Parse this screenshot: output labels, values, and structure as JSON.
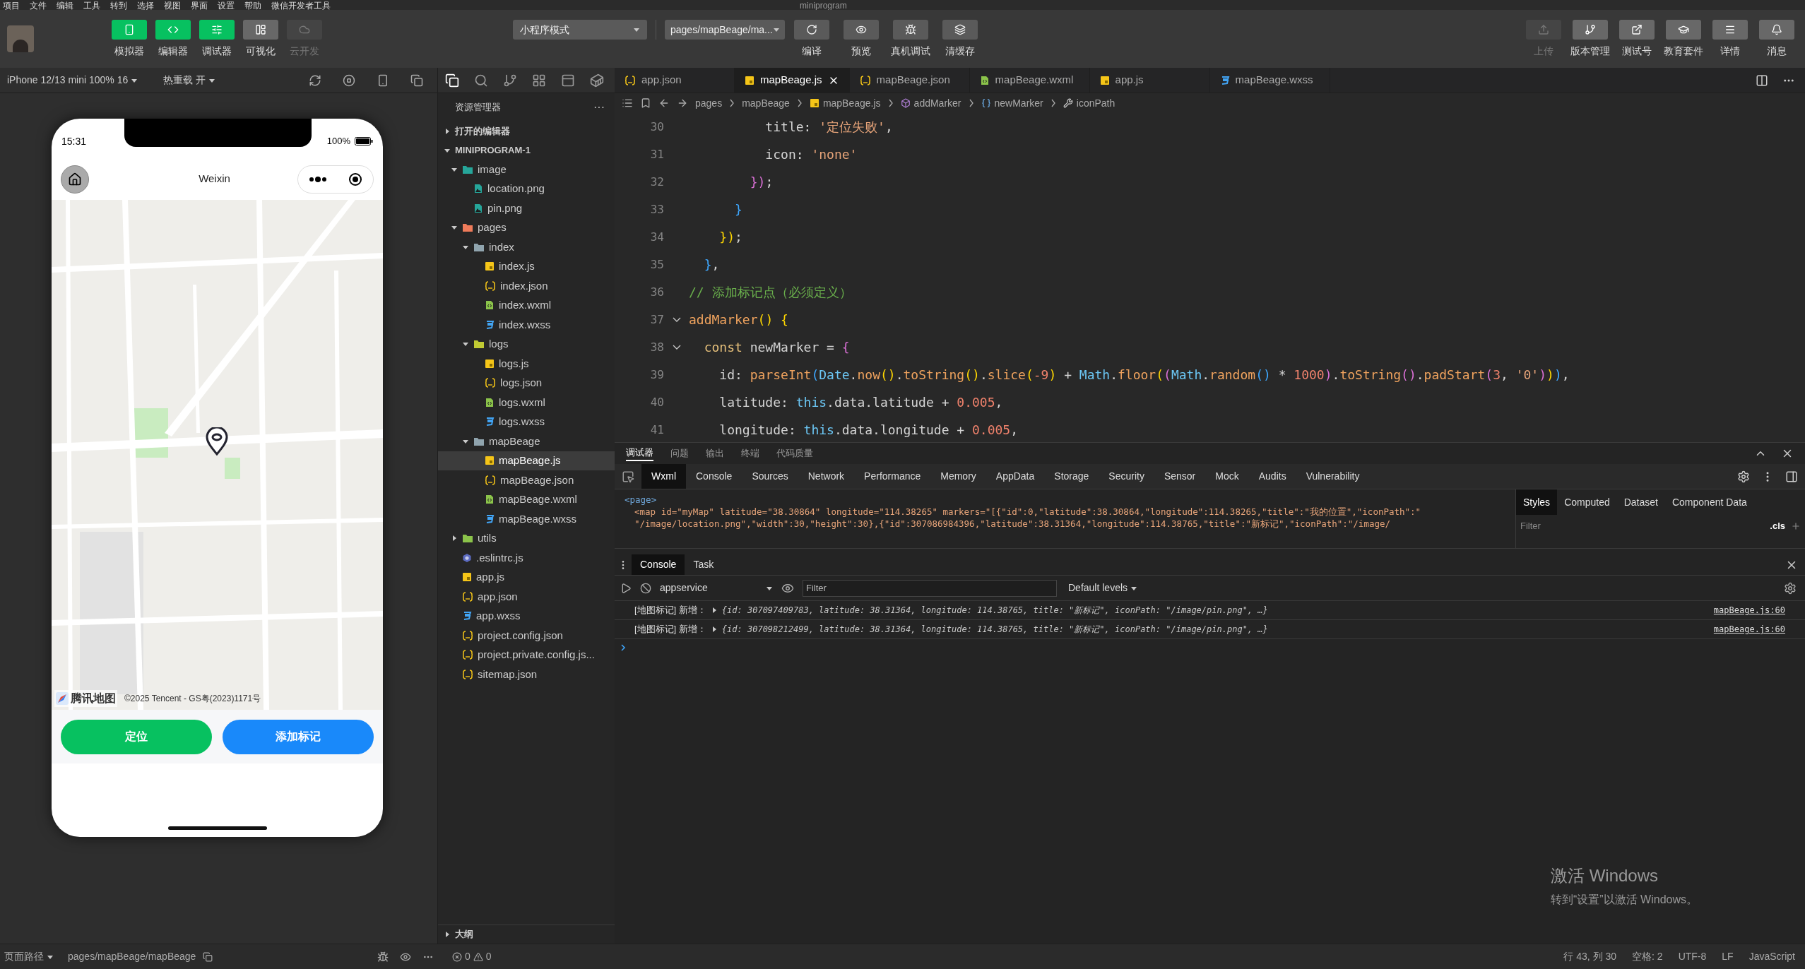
{
  "menu_bar": {
    "items": [
      "项目",
      "文件",
      "编辑",
      "工具",
      "转到",
      "选择",
      "视图",
      "界面",
      "设置",
      "帮助",
      "微信开发者工具"
    ],
    "title": "miniprogram"
  },
  "toolbar": {
    "left_buttons": [
      {
        "label": "模拟器",
        "selected": true,
        "disabled": false
      },
      {
        "label": "编辑器",
        "selected": true,
        "disabled": false
      },
      {
        "label": "调试器",
        "selected": true,
        "disabled": false
      },
      {
        "label": "可视化",
        "selected": false,
        "disabled": false
      },
      {
        "label": "云开发",
        "selected": false,
        "disabled": true
      }
    ],
    "mode_select": "小程序模式",
    "page_select": "pages/mapBeage/ma...",
    "center_buttons": [
      "编译",
      "预览",
      "真机调试",
      "清缓存"
    ],
    "right_buttons": [
      {
        "label": "上传",
        "disabled": true
      },
      {
        "label": "版本管理",
        "disabled": false
      },
      {
        "label": "测试号",
        "disabled": false
      },
      {
        "label": "教育套件",
        "disabled": false
      },
      {
        "label": "详情",
        "disabled": false
      },
      {
        "label": "消息",
        "disabled": false
      }
    ]
  },
  "simulator": {
    "device": "iPhone 12/13 mini 100% 16",
    "hot_reload": "热重载 开",
    "phone": {
      "time": "15:31",
      "battery": "100%",
      "nav_title": "Weixin",
      "map_logo": "腾讯地图",
      "map_copyright": "©2025 Tencent - GS粤(2023)1171号",
      "buttons": [
        {
          "label": "定位",
          "color": "#07c160"
        },
        {
          "label": "添加标记",
          "color": "#1989fa"
        }
      ]
    }
  },
  "explorer": {
    "title": "资源管理器",
    "more": "···",
    "sections": [
      {
        "label": "打开的编辑器",
        "expanded": false
      },
      {
        "label": "MINIPROGRAM-1",
        "expanded": true
      }
    ],
    "tree": [
      {
        "name": "image",
        "kind": "folder-image",
        "expanded": true,
        "selected": false,
        "children": [
          {
            "name": "location.png",
            "kind": "png",
            "selected": false
          },
          {
            "name": "pin.png",
            "kind": "png",
            "selected": false
          }
        ]
      },
      {
        "name": "pages",
        "kind": "folder-pages",
        "expanded": true,
        "selected": false,
        "children": [
          {
            "name": "index",
            "kind": "folder",
            "expanded": true,
            "selected": false,
            "children": [
              {
                "name": "index.js",
                "kind": "js",
                "selected": false
              },
              {
                "name": "index.json",
                "kind": "json",
                "selected": false
              },
              {
                "name": "index.wxml",
                "kind": "wxml",
                "selected": false
              },
              {
                "name": "index.wxss",
                "kind": "wxss",
                "selected": false
              }
            ]
          },
          {
            "name": "logs",
            "kind": "folder-logs",
            "expanded": true,
            "selected": false,
            "children": [
              {
                "name": "logs.js",
                "kind": "js",
                "selected": false
              },
              {
                "name": "logs.json",
                "kind": "json",
                "selected": false
              },
              {
                "name": "logs.wxml",
                "kind": "wxml",
                "selected": false
              },
              {
                "name": "logs.wxss",
                "kind": "wxss",
                "selected": false
              }
            ]
          },
          {
            "name": "mapBeage",
            "kind": "folder",
            "expanded": true,
            "selected": false,
            "children": [
              {
                "name": "mapBeage.js",
                "kind": "js",
                "selected": true
              },
              {
                "name": "mapBeage.json",
                "kind": "json",
                "selected": false
              },
              {
                "name": "mapBeage.wxml",
                "kind": "wxml",
                "selected": false
              },
              {
                "name": "mapBeage.wxss",
                "kind": "wxss",
                "selected": false
              }
            ]
          }
        ]
      },
      {
        "name": "utils",
        "kind": "folder-utils",
        "expanded": false,
        "selected": false
      },
      {
        "name": ".eslintrc.js",
        "kind": "eslint",
        "selected": false
      },
      {
        "name": "app.js",
        "kind": "js",
        "selected": false
      },
      {
        "name": "app.json",
        "kind": "json",
        "selected": false
      },
      {
        "name": "app.wxss",
        "kind": "wxss",
        "selected": false
      },
      {
        "name": "project.config.json",
        "kind": "json",
        "selected": false
      },
      {
        "name": "project.private.config.js...",
        "kind": "json",
        "selected": false
      },
      {
        "name": "sitemap.json",
        "kind": "json",
        "selected": false
      }
    ],
    "outline": {
      "label": "大纲",
      "expanded": false
    },
    "errors": "0",
    "warnings": "0"
  },
  "editor": {
    "tabs": [
      {
        "label": "app.json",
        "kind": "json",
        "selected": false
      },
      {
        "label": "mapBeage.js",
        "kind": "js",
        "selected": true
      },
      {
        "label": "mapBeage.json",
        "kind": "json",
        "selected": false
      },
      {
        "label": "mapBeage.wxml",
        "kind": "wxml",
        "selected": false
      },
      {
        "label": "app.js",
        "kind": "js",
        "selected": false
      },
      {
        "label": "mapBeage.wxss",
        "kind": "wxss",
        "selected": false
      }
    ],
    "breadcrumb": [
      "pages",
      "mapBeage",
      "mapBeage.js",
      "addMarker",
      "newMarker",
      "iconPath"
    ],
    "lines": [
      {
        "number": "30",
        "fold": false,
        "tokens": [
          {
            "kind": "key",
            "text": "          title: "
          },
          {
            "kind": "str",
            "text": "'定位失败'"
          },
          {
            "kind": "p",
            "text": ","
          }
        ]
      },
      {
        "number": "31",
        "fold": false,
        "tokens": [
          {
            "kind": "key",
            "text": "          icon: "
          },
          {
            "kind": "str",
            "text": "'none'"
          }
        ]
      },
      {
        "number": "32",
        "fold": false,
        "tokens": [
          {
            "kind": "b2",
            "text": "        })"
          },
          {
            "kind": "p",
            "text": ";"
          }
        ]
      },
      {
        "number": "33",
        "fold": false,
        "tokens": [
          {
            "kind": "b3",
            "text": "      }"
          }
        ]
      },
      {
        "number": "34",
        "fold": false,
        "tokens": [
          {
            "kind": "b1",
            "text": "    })"
          },
          {
            "kind": "p",
            "text": ";"
          }
        ]
      },
      {
        "number": "35",
        "fold": false,
        "tokens": [
          {
            "kind": "b3",
            "text": "  }"
          },
          {
            "kind": "p",
            "text": ","
          }
        ]
      },
      {
        "number": "36",
        "fold": false,
        "tokens": [
          {
            "kind": "comment",
            "text": "// 添加标记点（必须定义）"
          }
        ]
      },
      {
        "number": "37",
        "fold": true,
        "tokens": [
          {
            "kind": "fn",
            "text": "addMarker"
          },
          {
            "kind": "b1",
            "text": "()"
          },
          {
            "kind": "b1",
            "text": " {"
          }
        ]
      },
      {
        "number": "38",
        "fold": true,
        "tokens": [
          {
            "kind": "kw",
            "text": "  const"
          },
          {
            "kind": "p",
            "text": " newMarker = "
          },
          {
            "kind": "b2",
            "text": "{"
          }
        ]
      },
      {
        "number": "39",
        "fold": false,
        "tokens": [
          {
            "kind": "key",
            "text": "    id: "
          },
          {
            "kind": "fn",
            "text": "parseInt"
          },
          {
            "kind": "b3",
            "text": "("
          },
          {
            "kind": "obj",
            "text": "Date"
          },
          {
            "kind": "p",
            "text": "."
          },
          {
            "kind": "fn",
            "text": "now"
          },
          {
            "kind": "b1",
            "text": "()"
          },
          {
            "kind": "p",
            "text": "."
          },
          {
            "kind": "fn",
            "text": "toString"
          },
          {
            "kind": "b1",
            "text": "()"
          },
          {
            "kind": "p",
            "text": "."
          },
          {
            "kind": "fn",
            "text": "slice"
          },
          {
            "kind": "b1",
            "text": "("
          },
          {
            "kind": "num",
            "text": "-9"
          },
          {
            "kind": "b1",
            "text": ")"
          },
          {
            "kind": "p",
            "text": " + "
          },
          {
            "kind": "obj",
            "text": "Math"
          },
          {
            "kind": "p",
            "text": "."
          },
          {
            "kind": "fn",
            "text": "floor"
          },
          {
            "kind": "b1",
            "text": "("
          },
          {
            "kind": "b2",
            "text": "("
          },
          {
            "kind": "obj",
            "text": "Math"
          },
          {
            "kind": "p",
            "text": "."
          },
          {
            "kind": "fn",
            "text": "random"
          },
          {
            "kind": "b3",
            "text": "()"
          },
          {
            "kind": "p",
            "text": " * "
          },
          {
            "kind": "num",
            "text": "1000"
          },
          {
            "kind": "b2",
            "text": ")"
          },
          {
            "kind": "p",
            "text": "."
          },
          {
            "kind": "fn",
            "text": "toString"
          },
          {
            "kind": "b2",
            "text": "()"
          },
          {
            "kind": "p",
            "text": "."
          },
          {
            "kind": "fn",
            "text": "padStart"
          },
          {
            "kind": "b2",
            "text": "("
          },
          {
            "kind": "num",
            "text": "3"
          },
          {
            "kind": "p",
            "text": ", "
          },
          {
            "kind": "str",
            "text": "'0'"
          },
          {
            "kind": "b2",
            "text": ")"
          },
          {
            "kind": "b1",
            "text": ")"
          },
          {
            "kind": "b3",
            "text": ")"
          },
          {
            "kind": "p",
            "text": ","
          }
        ]
      },
      {
        "number": "40",
        "fold": false,
        "tokens": [
          {
            "kind": "key",
            "text": "    latitude: "
          },
          {
            "kind": "obj",
            "text": "this"
          },
          {
            "kind": "p",
            "text": ".data.latitude + "
          },
          {
            "kind": "num",
            "text": "0.005"
          },
          {
            "kind": "p",
            "text": ","
          }
        ]
      },
      {
        "number": "41",
        "fold": false,
        "tokens": [
          {
            "kind": "key",
            "text": "    longitude: "
          },
          {
            "kind": "obj",
            "text": "this"
          },
          {
            "kind": "p",
            "text": ".data.longitude + "
          },
          {
            "kind": "num",
            "text": "0.005"
          },
          {
            "kind": "p",
            "text": ","
          }
        ]
      }
    ]
  },
  "devtools": {
    "top_tabs": [
      {
        "label": "调试器",
        "selected": true
      },
      {
        "label": "问题",
        "selected": false
      },
      {
        "label": "输出",
        "selected": false
      },
      {
        "label": "终端",
        "selected": false
      },
      {
        "label": "代码质量",
        "selected": false
      }
    ],
    "panel_tabs": [
      {
        "label": "Wxml",
        "selected": true
      },
      {
        "label": "Console",
        "selected": false
      },
      {
        "label": "Sources",
        "selected": false
      },
      {
        "label": "Network",
        "selected": false
      },
      {
        "label": "Performance",
        "selected": false
      },
      {
        "label": "Memory",
        "selected": false
      },
      {
        "label": "AppData",
        "selected": false
      },
      {
        "label": "Storage",
        "selected": false
      },
      {
        "label": "Security",
        "selected": false
      },
      {
        "label": "Sensor",
        "selected": false
      },
      {
        "label": "Mock",
        "selected": false
      },
      {
        "label": "Audits",
        "selected": false
      },
      {
        "label": "Vulnerability",
        "selected": false
      }
    ],
    "wxml_lines": [
      {
        "kind": "tag",
        "text": "<page>"
      },
      {
        "kind": "attrs",
        "text": "<map id=\"myMap\" latitude=\"38.30864\" longitude=\"114.38265\" markers=\"[{\"id\":0,\"latitude\":38.30864,\"longitude\":114.38265,\"title\":\"我的位置\",\"iconPath\":\""
      },
      {
        "kind": "attrs",
        "text": "\"/image/location.png\",\"width\":30,\"height\":30},{\"id\":307086984396,\"latitude\":38.31364,\"longitude\":114.38765,\"title\":\"新标记\",\"iconPath\":\"/image/"
      }
    ],
    "style_tabs": [
      {
        "label": "Styles",
        "selected": true
      },
      {
        "label": "Computed",
        "selected": false
      },
      {
        "label": "Dataset",
        "selected": false
      },
      {
        "label": "Component Data",
        "selected": false
      }
    ],
    "style_filter": {
      "placeholder": "Filter"
    },
    "cls": ".cls",
    "drawer_tabs": [
      {
        "label": "Console",
        "selected": true
      },
      {
        "label": "Task",
        "selected": false
      }
    ],
    "context": "appservice",
    "console_filter": {
      "placeholder": "Filter"
    },
    "levels": "Default levels",
    "logs": [
      {
        "prefix": "[地图标记] 新增：",
        "object": "{id: 307097409783, latitude: 38.31364, longitude: 114.38765, title: \"新标记\", iconPath: \"/image/pin.png\", …}",
        "source": "mapBeage.js:60"
      },
      {
        "prefix": "[地图标记] 新增：",
        "object": "{id: 307098212499, latitude: 38.31364, longitude: 114.38765, title: \"新标记\", iconPath: \"/image/pin.png\", …}",
        "source": "mapBeage.js:60"
      }
    ]
  },
  "activation": {
    "title": "激活 Windows",
    "hint": "转到“设置”以激活 Windows。"
  },
  "status_bar": {
    "page_path_label": "页面路径",
    "page_path": "pages/mapBeage/mapBeage",
    "right": [
      "行 43, 列 30",
      "空格: 2",
      "UTF-8",
      "LF",
      "JavaScript"
    ]
  }
}
